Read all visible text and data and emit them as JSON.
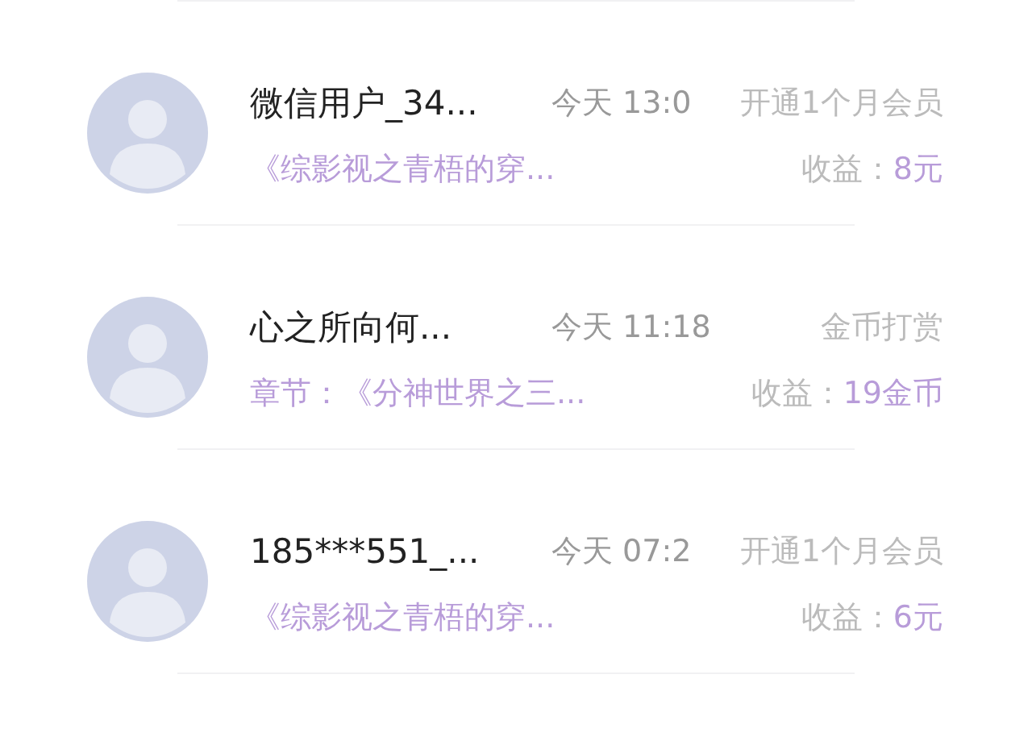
{
  "records": [
    {
      "user": "微信用户_34...",
      "time": "今天 13:0",
      "action": "开通1个月会员",
      "work": "《综影视之青梧的穿...",
      "income_label": "收益：",
      "income_value": "8元"
    },
    {
      "user": "心之所向何...",
      "time": "今天 11:18",
      "action": "金币打赏",
      "work": "章节：《分神世界之三...",
      "income_label": "收益：",
      "income_value": "19金币"
    },
    {
      "user": "185***551_...",
      "time": "今天 07:2",
      "action": "开通1个月会员",
      "work": "《综影视之青梧的穿...",
      "income_label": "收益：",
      "income_value": "6元"
    }
  ]
}
